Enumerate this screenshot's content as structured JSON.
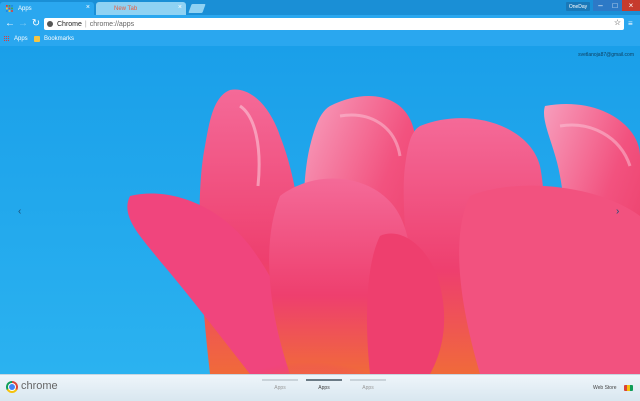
{
  "tabs": [
    {
      "label": "Apps",
      "active": true
    },
    {
      "label": "New Tab",
      "active": false
    }
  ],
  "window": {
    "profile_label": "OneDay",
    "minimize": "–",
    "maximize": "□",
    "close": "×"
  },
  "toolbar": {
    "omnibox_label": "Chrome",
    "omnibox_separator": "|",
    "omnibox_url": "chrome://apps"
  },
  "bookmarks": {
    "apps_label": "Apps",
    "bookmarks_label": "Bookmarks"
  },
  "user": {
    "email": "svetlanoja87@gmail.com"
  },
  "bottom": {
    "brand": "chrome",
    "pages": [
      {
        "label": "Apps",
        "active": false
      },
      {
        "label": "Apps",
        "active": true
      },
      {
        "label": "Apps",
        "active": false
      }
    ],
    "webstore_label": "Web Store"
  },
  "icons": {
    "back": "back-arrow-icon",
    "forward": "forward-arrow-icon",
    "reload": "reload-icon",
    "star": "star-icon",
    "menu": "menu-icon"
  },
  "colors": {
    "accent": "#2aa7ef",
    "tab_strip": "#1a8fd6",
    "sky": "#1fa8ee",
    "petal": "#f0457d"
  }
}
